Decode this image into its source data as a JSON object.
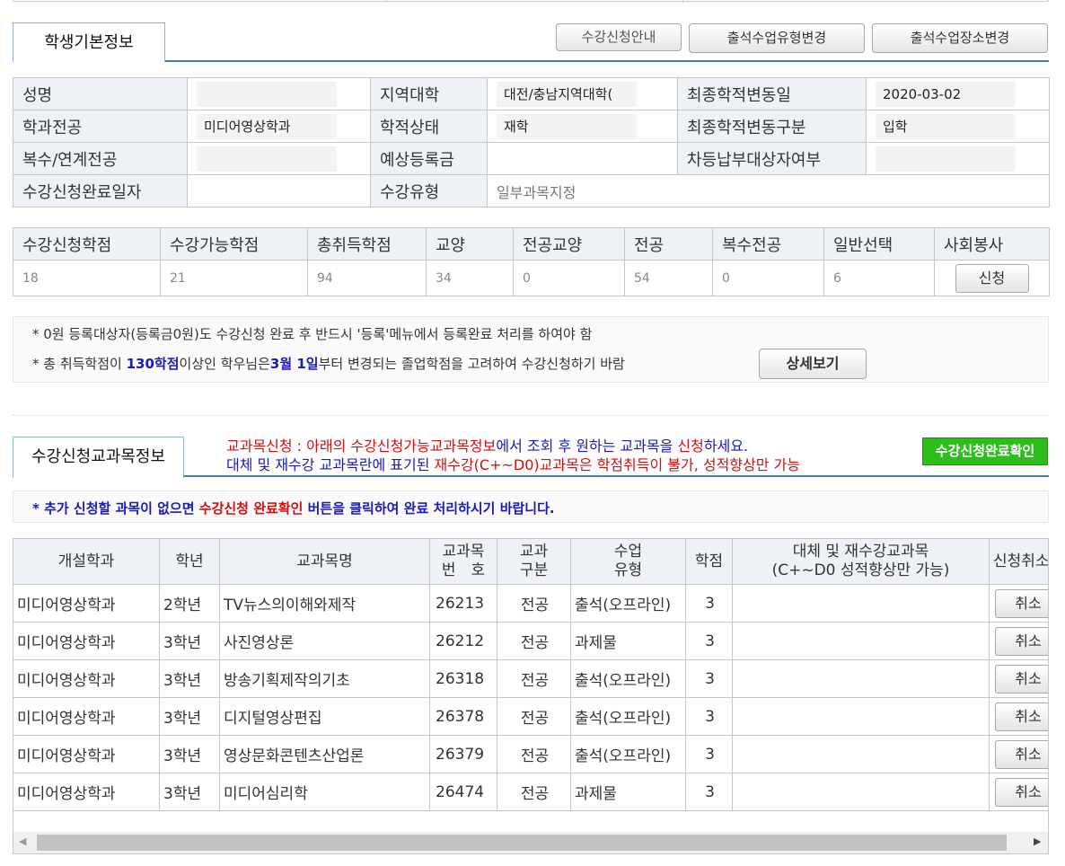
{
  "student_tab": {
    "label": "학생기본정보"
  },
  "top_buttons": {
    "guide": "수강신청안내",
    "change_type": "출석수업유형변경",
    "change_place": "출석수업장소변경"
  },
  "info": {
    "rows": [
      [
        {
          "label": "성명",
          "value": ""
        },
        {
          "label": "지역대학",
          "value": "대전/충남지역대학("
        },
        {
          "label": "최종학적변동일",
          "value": "2020-03-02"
        }
      ],
      [
        {
          "label": "학과전공",
          "value": "미디어영상학과"
        },
        {
          "label": "학적상태",
          "value": "재학"
        },
        {
          "label": "최종학적변동구분",
          "value": "입학"
        }
      ],
      [
        {
          "label": "복수/연계전공",
          "value": ""
        },
        {
          "label": "예상등록금",
          "value": ""
        },
        {
          "label": "차등납부대상자여부",
          "value": ""
        }
      ]
    ],
    "completion_date_label": "수강신청완료일자",
    "completion_date_value": "",
    "course_type_label": "수강유형",
    "course_type_value": "일부과목지정"
  },
  "credits": {
    "headers": [
      "수강신청학점",
      "수강가능학점",
      "총취득학점",
      "교양",
      "전공교양",
      "전공",
      "복수전공",
      "일반선택",
      "사회봉사"
    ],
    "values": [
      "18",
      "21",
      "94",
      "34",
      "0",
      "54",
      "0",
      "6"
    ],
    "apply_button": "신청"
  },
  "notice": {
    "line1": "* 0원 등록대상자(등록금0원)도 수강신청 완료 후 반드시 '등록'메뉴에서 등록완료 처리를 하여야 함",
    "line2_a": "* 총 취득학점이 ",
    "line2_b": "130학점",
    "line2_c": "이상인 학우님은",
    "line2_d": "3월 1일",
    "line2_e": "부터 변경되는 졸업학점을 고려하여 수강신청하기 바람",
    "detail_button": "상세보기"
  },
  "course_tab": {
    "label": "수강신청교과목정보"
  },
  "course_msg": {
    "line1_a": "교과목신청 : 아래의 ",
    "line1_b": "수강신청가능교과목정보",
    "line1_c": "에서 조회 후 원하는 교과목을 ",
    "line1_d": "신청",
    "line1_e": "하세요.",
    "line2_a": "대체 및 재수강 교과목란에 표기된 ",
    "line2_b": "재수강(C+~D0)교과목은 학점취득이 불가, 성적향상만 가능"
  },
  "complete_button": "수강신청완료확인",
  "reminder": {
    "a": "* 추가 신청할 과목이 없으면 ",
    "b": "수강신청 완료확인",
    "c": " 버튼을 클릭하여 완료 처리하시기 바랍니다."
  },
  "course_table": {
    "headers": {
      "dept": "개설학과",
      "year": "학년",
      "name": "교과목명",
      "code_1": "교과목",
      "code_2": "번　호",
      "kind_1": "교과",
      "kind_2": "구분",
      "type_1": "수업",
      "type_2": "유형",
      "credit": "학점",
      "alt_1": "대체 및 재수강교과목",
      "alt_2": "(C+~D0 성적향상만 가능)",
      "cancel": "신청취소"
    },
    "cancel_label": "취소",
    "rows": [
      {
        "dept": "미디어영상학과",
        "year": "2학년",
        "name": "TV뉴스의이해와제작",
        "code": "26213",
        "kind": "전공",
        "type": "출석(오프라인)",
        "credit": "3",
        "alt": ""
      },
      {
        "dept": "미디어영상학과",
        "year": "3학년",
        "name": "사진영상론",
        "code": "26212",
        "kind": "전공",
        "type": "과제물",
        "credit": "3",
        "alt": ""
      },
      {
        "dept": "미디어영상학과",
        "year": "3학년",
        "name": "방송기획제작의기초",
        "code": "26318",
        "kind": "전공",
        "type": "출석(오프라인)",
        "credit": "3",
        "alt": ""
      },
      {
        "dept": "미디어영상학과",
        "year": "3학년",
        "name": "디지털영상편집",
        "code": "26378",
        "kind": "전공",
        "type": "출석(오프라인)",
        "credit": "3",
        "alt": ""
      },
      {
        "dept": "미디어영상학과",
        "year": "3학년",
        "name": "영상문화콘텐츠산업론",
        "code": "26379",
        "kind": "전공",
        "type": "출석(오프라인)",
        "credit": "3",
        "alt": ""
      },
      {
        "dept": "미디어영상학과",
        "year": "3학년",
        "name": "미디어심리학",
        "code": "26474",
        "kind": "전공",
        "type": "과제물",
        "credit": "3",
        "alt": ""
      }
    ]
  },
  "scrollbar": {
    "left_arrow": "◀",
    "right_arrow": "▶"
  }
}
